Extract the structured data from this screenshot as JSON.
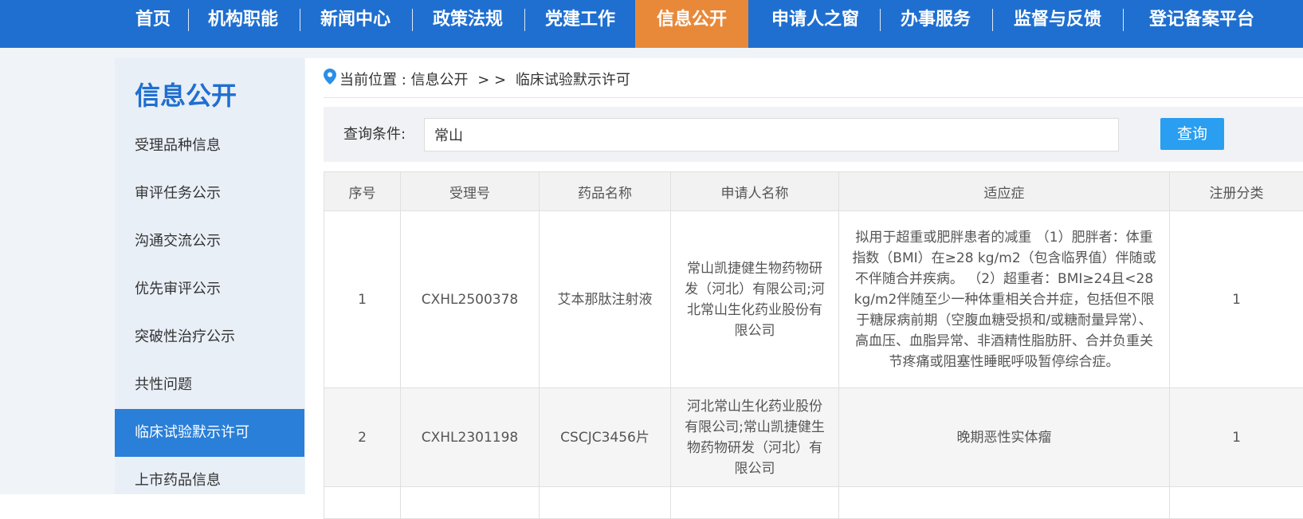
{
  "nav": {
    "items": [
      "首页",
      "机构职能",
      "新闻中心",
      "政策法规",
      "党建工作",
      "信息公开",
      "申请人之窗",
      "办事服务",
      "监督与反馈",
      "登记备案平台"
    ],
    "active_index": 5,
    "bg_color": "#1f6fd0",
    "active_color": "#e8893a"
  },
  "sidebar": {
    "title": "信息公开",
    "items": [
      "受理品种信息",
      "审评任务公示",
      "沟通交流公示",
      "优先审评公示",
      "突破性治疗公示",
      "共性问题",
      "临床试验默示许可",
      "上市药品信息"
    ],
    "active_index": 6
  },
  "breadcrumb": {
    "prefix": "当前位置 : 信息公开",
    "separator": "> >",
    "current": "临床试验默示许可"
  },
  "search": {
    "label": "查询条件:",
    "value": "常山",
    "button_label": "查询",
    "button_color": "#2a9ef0"
  },
  "table": {
    "headers": [
      "序号",
      "受理号",
      "药品名称",
      "申请人名称",
      "适应症",
      "注册分类"
    ],
    "rows": [
      {
        "index": "1",
        "accept_no": "CXHL2500378",
        "drug_name": "艾本那肽注射液",
        "applicant": "常山凯捷健生物药物研发（河北）有限公司;河北常山生化药业股份有限公司",
        "indication": "拟用于超重或肥胖患者的减重 （1）肥胖者：体重指数（BMI）在≥28 kg/m2（包含临界值）伴随或不伴随合并疾病。 （2）超重者：BMI≥24且<28 kg/m2伴随至少一种体重相关合并症，包括但不限于糖尿病前期（空腹血糖受损和/或糖耐量异常）、高血压、血脂异常、非酒精性脂肪肝、合并负重关节疼痛或阻塞性睡眠呼吸暂停综合症。",
        "category": "1"
      },
      {
        "index": "2",
        "accept_no": "CXHL2301198",
        "drug_name": "CSCJC3456片",
        "applicant": "河北常山生化药业股份有限公司;常山凯捷健生物药物研发（河北）有限公司",
        "indication": "晚期恶性实体瘤",
        "category": "1"
      }
    ]
  }
}
